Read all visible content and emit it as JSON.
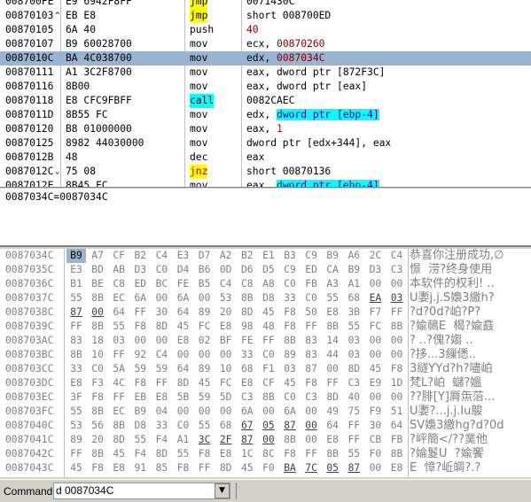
{
  "disasm": {
    "rows": [
      {
        "addr": "008700FE",
        "bytes": "E9 6942F8FF",
        "mnem": "jmp",
        "ops": "0071430C",
        "style": "top",
        "mnem_hl": "y"
      },
      {
        "addr": "00870103",
        "bytes": "EB E8",
        "mnem": "jmp",
        "ops": "short 008700ED",
        "marker": "^",
        "mnem_hl": "y"
      },
      {
        "addr": "00870105",
        "bytes": "6A 40",
        "mnem": "push",
        "ops": "40",
        "ops_color": "maroon"
      },
      {
        "addr": "00870107",
        "bytes": "B9 60028700",
        "mnem": "mov",
        "ops": "ecx, 00870260",
        "ops_color": "maroon_tail"
      },
      {
        "addr": "0087010C",
        "bytes": "BA 4C038700",
        "mnem": "mov",
        "ops": "edx, 0087034C",
        "ops_color": "maroon_tail",
        "selected": true
      },
      {
        "addr": "00870111",
        "bytes": "A1 3C2F8700",
        "mnem": "mov",
        "ops": "eax, dword ptr [872F3C]"
      },
      {
        "addr": "00870116",
        "bytes": "8B00",
        "mnem": "mov",
        "ops": "eax, dword ptr [eax]"
      },
      {
        "addr": "00870118",
        "bytes": "E8 CFC9FBFF",
        "mnem": "call",
        "ops": "0082CAEC",
        "mnem_hl": "cy"
      },
      {
        "addr": "0087011D",
        "bytes": "8B55 FC",
        "mnem": "mov",
        "ops_pre": "edx, ",
        "ops_hl": "dword ptr [ebp-4]"
      },
      {
        "addr": "00870120",
        "bytes": "B8 01000000",
        "mnem": "mov",
        "ops": "eax, 1",
        "ops_color": "red_tail"
      },
      {
        "addr": "00870125",
        "bytes": "8982 44030000",
        "mnem": "mov",
        "ops": "dword ptr [edx+344], eax"
      },
      {
        "addr": "0087012B",
        "bytes": "48",
        "mnem": "dec",
        "ops": "eax"
      },
      {
        "addr": "0087012C",
        "bytes": "75 08",
        "mnem": "jnz",
        "ops": "short 00870136",
        "marker": "v",
        "mnem_hl": "y",
        "mnem_color": "red"
      },
      {
        "addr": "0087012E",
        "bytes": "8B45 FC",
        "mnem": "mov",
        "ops_pre": "eax, ",
        "ops_hl": "dword ptr [ebp-4]",
        "style": "bottom"
      }
    ]
  },
  "info": {
    "text": "0087034C=0087034C"
  },
  "dump": {
    "rows": [
      {
        "addr": "0087034C",
        "bytes": [
          "B9",
          "A7",
          "CF",
          "B2",
          "C4",
          "E3",
          "D7",
          "A2",
          "B2",
          "E1",
          "B3",
          "C9",
          "B9",
          "A6",
          "2C",
          "C4"
        ],
        "ascii": "恭喜你注册成功,∅"
      },
      {
        "addr": "0087035C",
        "bytes": [
          "E3",
          "BD",
          "AB",
          "D3",
          "C0",
          "D4",
          "B6",
          "0D",
          "D6",
          "D5",
          "C9",
          "ED",
          "CA",
          "B9",
          "D3",
          "C3"
        ],
        "ascii": "憬  涝?终身使用"
      },
      {
        "addr": "0087036C",
        "bytes": [
          "B1",
          "BE",
          "C8",
          "ED",
          "BC",
          "FE",
          "B5",
          "C4",
          "C8",
          "A8",
          "C0",
          "FB",
          "A3",
          "A1",
          "00",
          "00"
        ],
        "ascii": "本软件的权利! .."
      },
      {
        "addr": "0087037C",
        "bytes": [
          "55",
          "8B",
          "EC",
          "6A",
          "00",
          "6A",
          "00",
          "53",
          "8B",
          "D8",
          "33",
          "C0",
          "55",
          "68",
          "EA",
          "03"
        ],
        "ascii": "U嬱j.j.S嬝3繳h?"
      },
      {
        "addr": "0087038C",
        "bytes": [
          "87",
          "00",
          "64",
          "FF",
          "30",
          "64",
          "89",
          "20",
          "8D",
          "45",
          "F8",
          "50",
          "E8",
          "3B",
          "F7",
          "FF"
        ],
        "ascii": "?d?0d?岶?P?"
      },
      {
        "addr": "0087039C",
        "bytes": [
          "FF",
          "8B",
          "55",
          "F8",
          "8D",
          "45",
          "FC",
          "E8",
          "98",
          "48",
          "F8",
          "FF",
          "8B",
          "55",
          "FC",
          "8B"
        ],
        "ascii": "?婾鳾E  楬?婾鼖"
      },
      {
        "addr": "008703AC",
        "bytes": [
          "83",
          "18",
          "03",
          "00",
          "00",
          "E8",
          "02",
          "BF",
          "FE",
          "FF",
          "8B",
          "83",
          "14",
          "03",
          "00",
          "00"
        ],
        "ascii": "? ..?傀?媰 .."
      },
      {
        "addr": "008703BC",
        "bytes": [
          "8B",
          "10",
          "FF",
          "92",
          "C4",
          "00",
          "00",
          "00",
          "33",
          "C0",
          "89",
          "83",
          "44",
          "03",
          "00",
          "00"
        ],
        "ascii": "?拸...3繅僁.."
      },
      {
        "addr": "008703CC",
        "bytes": [
          "33",
          "C0",
          "5A",
          "59",
          "59",
          "64",
          "89",
          "10",
          "68",
          "F1",
          "03",
          "87",
          "00",
          "8D",
          "45",
          "F8"
        ],
        "ascii": "3繸YYd?h?嚍岶"
      },
      {
        "addr": "008703DC",
        "bytes": [
          "E8",
          "F3",
          "4C",
          "F8",
          "FF",
          "8D",
          "45",
          "FC",
          "E8",
          "CF",
          "45",
          "F8",
          "FF",
          "C3",
          "E9",
          "1D"
        ],
        "ascii": "梵L?岶  蠩?媼"
      },
      {
        "addr": "008703EC",
        "bytes": [
          "3F",
          "F8",
          "FF",
          "EB",
          "E8",
          "5B",
          "59",
          "5D",
          "C3",
          "8B",
          "C0",
          "C3",
          "8D",
          "40",
          "00",
          "00"
        ],
        "ascii": "??腓[Y]脣缹菭..."
      },
      {
        "addr": "008703FC",
        "bytes": [
          "55",
          "8B",
          "EC",
          "B9",
          "04",
          "00",
          "00",
          "00",
          "6A",
          "00",
          "6A",
          "00",
          "49",
          "75",
          "F9",
          "51"
        ],
        "ascii": "U嬱?...j.j.Iu鵔"
      },
      {
        "addr": "0087040C",
        "bytes": [
          "53",
          "56",
          "8B",
          "D8",
          "33",
          "C0",
          "55",
          "68",
          "67",
          "05",
          "87",
          "00",
          "64",
          "FF",
          "30",
          "64"
        ],
        "ascii": "SV嬝3繳hg?d?0d"
      },
      {
        "addr": "0087041C",
        "bytes": [
          "89",
          "20",
          "8D",
          "55",
          "F4",
          "A1",
          "3C",
          "2F",
          "87",
          "00",
          "8B",
          "00",
          "E8",
          "FF",
          "CB",
          "FB"
        ],
        "ascii": "?岼簡</??菐他"
      },
      {
        "addr": "0087042C",
        "bytes": [
          "FF",
          "8B",
          "45",
          "F4",
          "8D",
          "55",
          "F8",
          "E8",
          "1C",
          "8C",
          "F8",
          "FF",
          "8B",
          "55",
          "F0",
          "8B"
        ],
        "ascii": "?婨鬉U  ?婾饗"
      },
      {
        "addr": "0087043C",
        "bytes": [
          "45",
          "F8",
          "E8",
          "91",
          "85",
          "F8",
          "FF",
          "8D",
          "45",
          "F0",
          "BA",
          "7C",
          "05",
          "87",
          "00",
          "E8"
        ],
        "ascii": "E  慞?岴皗?.?"
      }
    ]
  },
  "command": {
    "label": "Command",
    "value": "d 0087034C",
    "dropdown_icon": "chevron-down-icon"
  },
  "colors": {
    "selection": "#99b4d1",
    "jump_highlight": "#ffff00",
    "call_highlight": "#00ffff",
    "constant": "#800000"
  }
}
